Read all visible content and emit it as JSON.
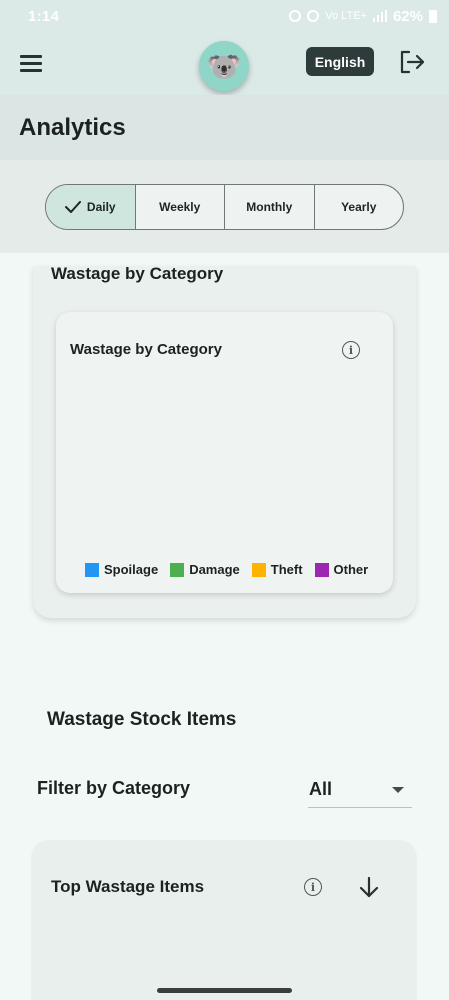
{
  "status_bar": {
    "time": "1:14",
    "network": "Vo LTE+",
    "battery": "62%"
  },
  "app_bar": {
    "avatar_emoji": "🐨",
    "language_label": "English"
  },
  "page": {
    "title": "Analytics"
  },
  "period_tabs": [
    {
      "label": "Daily",
      "selected": true
    },
    {
      "label": "Weekly",
      "selected": false
    },
    {
      "label": "Monthly",
      "selected": false
    },
    {
      "label": "Yearly",
      "selected": false
    }
  ],
  "wastage_section": {
    "title": "Wastage by Category",
    "chart_title": "Wastage by Category",
    "info_glyph": "i"
  },
  "chart_data": {
    "type": "pie",
    "title": "Wastage by Category",
    "categories": [
      "Spoilage",
      "Damage",
      "Theft",
      "Other"
    ],
    "values": [],
    "legend_position": "bottom",
    "colors": [
      "#2196f3",
      "#4caf50",
      "#ffb300",
      "#9c27b0"
    ]
  },
  "stock_section": {
    "title": "Wastage Stock Items",
    "filter_label": "Filter by Category",
    "filter_value": "All"
  },
  "top_items": {
    "title": "Top Wastage Items",
    "info_glyph": "i"
  },
  "colors": {
    "accent": "#cfe6df",
    "dark_button": "#2d3b3a",
    "app_bar": "#dbe9e7"
  }
}
